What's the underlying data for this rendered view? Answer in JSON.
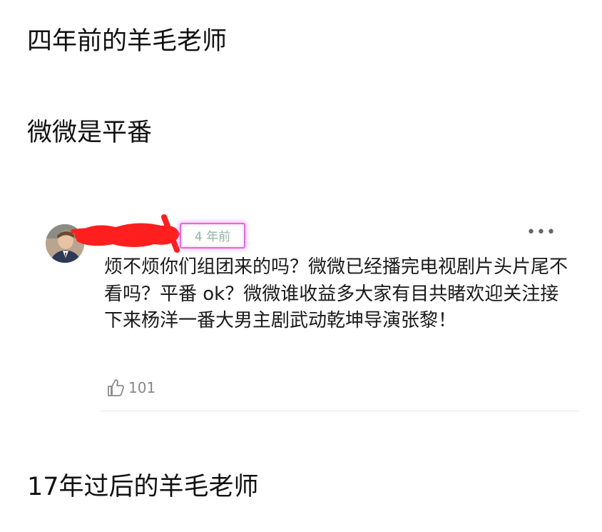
{
  "headings": {
    "top": "四年前的羊毛老师",
    "middle": "微微是平番",
    "bottom": "17年过后的羊毛老师"
  },
  "comment": {
    "timestamp": "4 年前",
    "more_label": "•••",
    "text": "烦不烦你们组团来的吗？微微已经播完电视剧片头片尾不看吗？平番 ok？微微谁收益多大家有目共睹欢迎关注接下来杨洋一番大男主剧武动乾坤导演张黎！",
    "likes": "101",
    "username_redacted": true
  },
  "colors": {
    "highlight_border": "#e26ad9",
    "redaction": "#ff1f1f",
    "timestamp_text": "#8fb6a4",
    "meta_text": "#888888"
  },
  "icons": {
    "like": "thumbs-up-icon",
    "more": "more-dots-icon",
    "avatar": "avatar"
  }
}
